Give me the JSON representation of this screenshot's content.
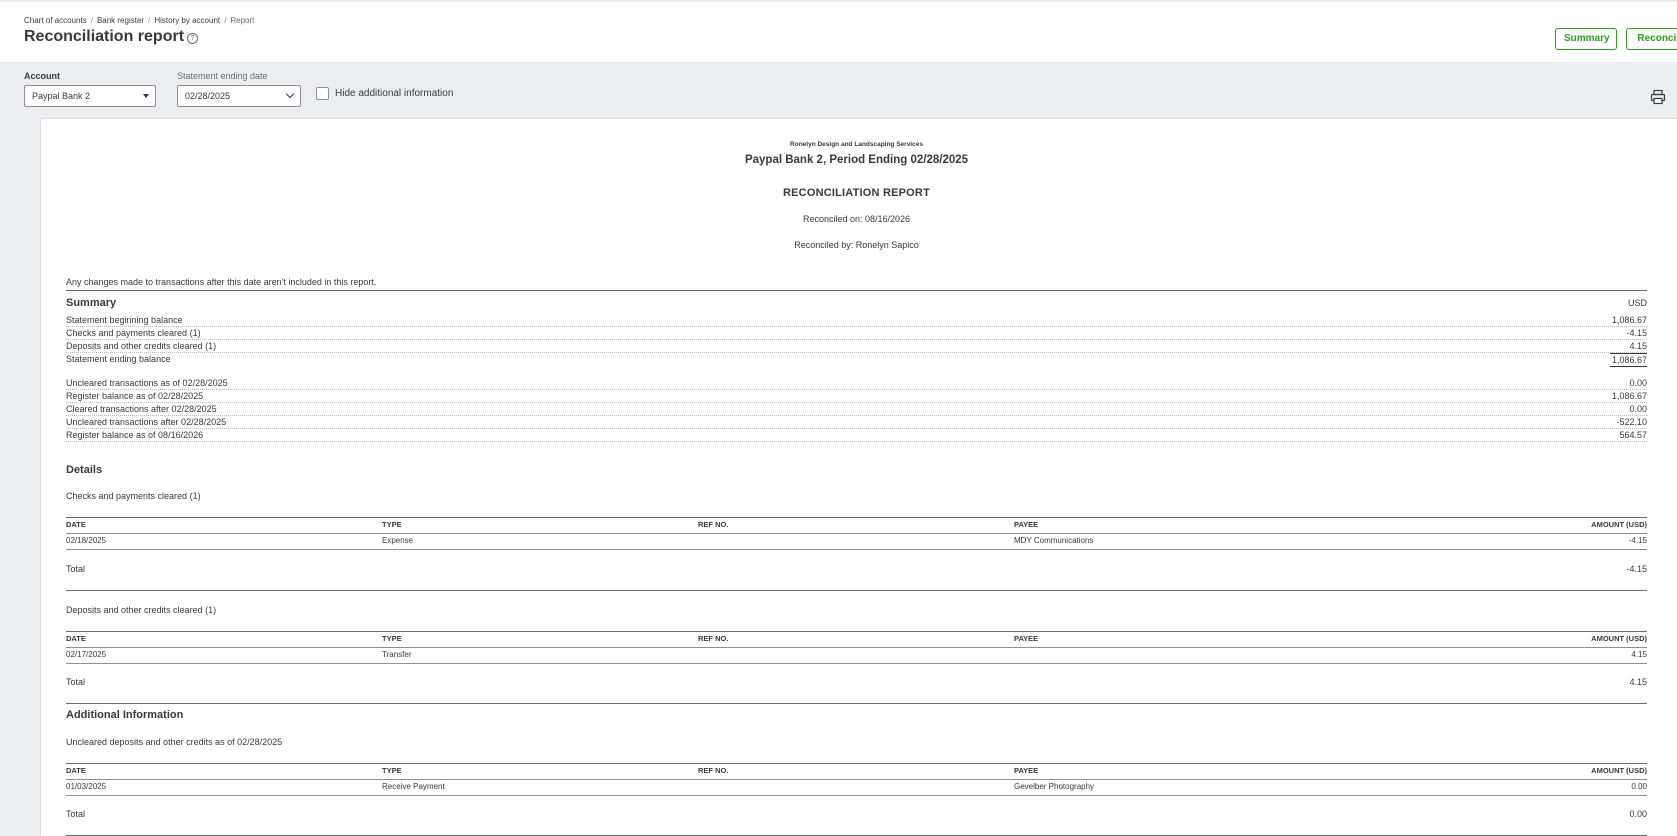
{
  "breadcrumb": {
    "items": [
      "Chart of accounts",
      "Bank register",
      "History by account"
    ],
    "current": "Report"
  },
  "page": {
    "title": "Reconciliation report",
    "help_icon": "help-circle-icon"
  },
  "actions": {
    "summary_label": "Summary",
    "reconcile_label": "Reconcile"
  },
  "filters": {
    "account_label": "Account",
    "account_value": "Paypal Bank 2",
    "date_label": "Statement ending date",
    "date_value": "02/28/2025",
    "hide_label": "Hide additional information",
    "hide_checked": false
  },
  "report": {
    "company": "Ronelyn Design and Landscaping Services",
    "subtitle": "Paypal Bank 2, Period Ending 02/28/2025",
    "title": "RECONCILIATION REPORT",
    "reconciled_on": "Reconciled on: 08/16/2026",
    "reconciled_by": "Reconciled by: Ronelyn Sapico",
    "note": "Any changes made to transactions after this date aren't included in this report.",
    "summary": {
      "heading": "Summary",
      "currency": "USD",
      "rows": [
        {
          "label": "Statement beginning balance",
          "value": "1,086.67"
        },
        {
          "label": "Checks and payments cleared (1)",
          "value": "-4.15"
        },
        {
          "label": "Deposits and other credits cleared (1)",
          "value": "4.15"
        },
        {
          "label": "Statement ending balance",
          "value": "1,086.67"
        }
      ],
      "rows2": [
        {
          "label": "Uncleared transactions as of 02/28/2025",
          "value": "0.00"
        },
        {
          "label": "Register balance as of 02/28/2025",
          "value": "1,086.67"
        },
        {
          "label": "Cleared transactions after 02/28/2025",
          "value": "0.00"
        },
        {
          "label": "Uncleared transactions after 02/28/2025",
          "value": "-522.10"
        },
        {
          "label": "Register balance as of 08/16/2026",
          "value": "564.57"
        }
      ]
    },
    "details": {
      "heading": "Details",
      "columns": [
        "DATE",
        "TYPE",
        "REF NO.",
        "PAYEE",
        "AMOUNT (USD)"
      ],
      "checks": {
        "title": "Checks and payments cleared (1)",
        "rows": [
          {
            "date": "02/18/2025",
            "type": "Expense",
            "ref": "",
            "payee": "MDY Communications",
            "amount": "-4.15"
          }
        ],
        "total_label": "Total",
        "total": "-4.15"
      },
      "deposits": {
        "title": "Deposits and other credits cleared (1)",
        "rows": [
          {
            "date": "02/17/2025",
            "type": "Transfer",
            "ref": "",
            "payee": "",
            "amount": "4.15"
          }
        ],
        "total_label": "Total",
        "total": "4.15"
      }
    },
    "additional": {
      "heading": "Additional Information",
      "uncleared": {
        "title": "Uncleared deposits and other credits as of 02/28/2025",
        "rows": [
          {
            "date": "01/03/2025",
            "type": "Receive Payment",
            "ref": "",
            "payee": "Gevelber Photography",
            "amount": "0.00"
          }
        ],
        "total_label": "Total",
        "total": "0.00"
      }
    }
  }
}
